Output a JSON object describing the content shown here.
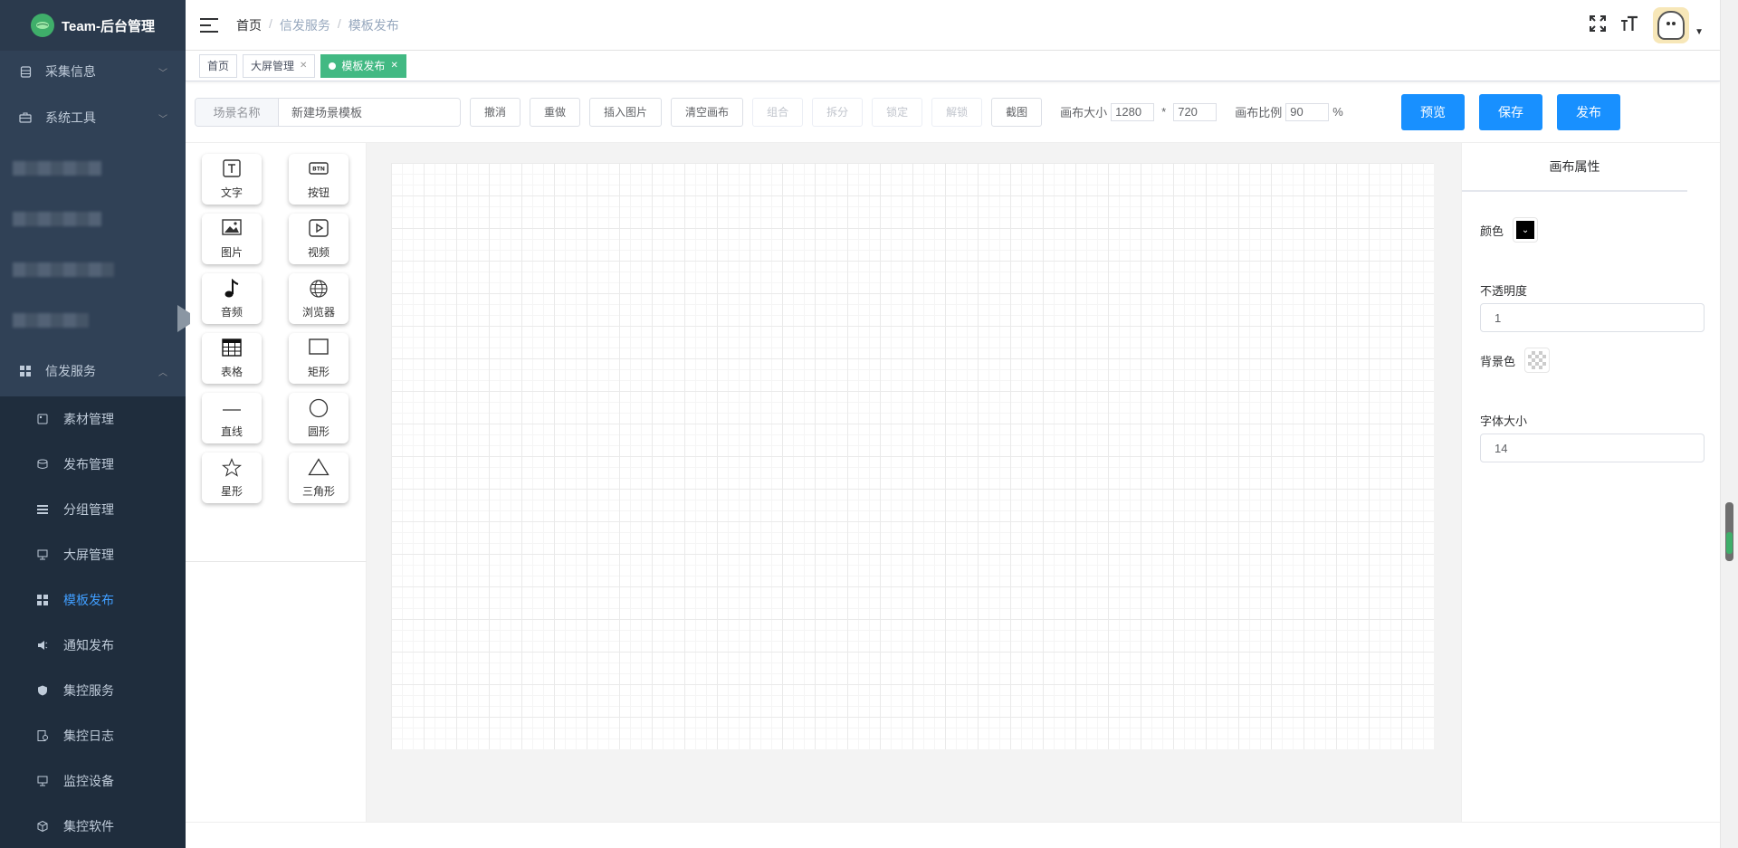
{
  "app": {
    "title": "Team-后台管理"
  },
  "sidebar": {
    "items": [
      {
        "label": "采集信息",
        "icon": "database-icon",
        "arrow": "﹀"
      },
      {
        "label": "系统工具",
        "icon": "toolbox-icon",
        "arrow": "﹀"
      },
      {
        "label": "信发服务",
        "icon": "grid-icon",
        "arrow": "︿"
      }
    ],
    "sub_items": [
      {
        "label": "素材管理",
        "icon": "material-icon"
      },
      {
        "label": "发布管理",
        "icon": "publish-icon"
      },
      {
        "label": "分组管理",
        "icon": "list-icon"
      },
      {
        "label": "大屏管理",
        "icon": "monitor-icon"
      },
      {
        "label": "模板发布",
        "icon": "grid-icon"
      },
      {
        "label": "通知发布",
        "icon": "speaker-icon"
      },
      {
        "label": "集控服务",
        "icon": "shield-icon"
      },
      {
        "label": "集控日志",
        "icon": "log-icon"
      },
      {
        "label": "监控设备",
        "icon": "monitor-icon"
      },
      {
        "label": "集控软件",
        "icon": "cube-icon"
      }
    ]
  },
  "header": {
    "breadcrumb": [
      "首页",
      "信发服务",
      "模板发布"
    ],
    "separator": "/"
  },
  "tags": [
    {
      "label": "首页",
      "closable": false
    },
    {
      "label": "大屏管理",
      "closable": true
    },
    {
      "label": "模板发布",
      "closable": true,
      "active": true
    }
  ],
  "toolbar": {
    "scene_label": "场景名称",
    "scene_value": "新建场景模板",
    "buttons": [
      "撤消",
      "重做",
      "插入图片",
      "清空画布",
      "组合",
      "拆分",
      "锁定",
      "解锁",
      "截图"
    ],
    "canvas_size_label": "画布大小",
    "width": "1280",
    "times": "*",
    "height": "720",
    "ratio_label": "画布比例",
    "ratio": "90",
    "percent": "%",
    "preview": "预览",
    "save": "保存",
    "publish": "发布"
  },
  "palette": [
    {
      "label": "文字",
      "icon": "text-icon"
    },
    {
      "label": "按钮",
      "icon": "button-icon"
    },
    {
      "label": "图片",
      "icon": "image-icon"
    },
    {
      "label": "视频",
      "icon": "video-icon"
    },
    {
      "label": "音频",
      "icon": "music-note-icon"
    },
    {
      "label": "浏览器",
      "icon": "globe-icon"
    },
    {
      "label": "表格",
      "icon": "table-icon"
    },
    {
      "label": "矩形",
      "icon": "rectangle-icon"
    },
    {
      "label": "直线",
      "icon": "line-icon"
    },
    {
      "label": "圆形",
      "icon": "circle-icon"
    },
    {
      "label": "星形",
      "icon": "star-icon"
    },
    {
      "label": "三角形",
      "icon": "triangle-icon"
    }
  ],
  "props": {
    "title": "画布属性",
    "color_label": "颜色",
    "color_value": "#000000",
    "opacity_label": "不透明度",
    "opacity_value": "1",
    "bg_label": "背景色",
    "font_size_label": "字体大小",
    "font_size_value": "14"
  },
  "colors": {
    "sidebar_bg": "#304156",
    "accent": "#409eff",
    "primary_btn": "#1890ff",
    "tag_active": "#42b983"
  }
}
